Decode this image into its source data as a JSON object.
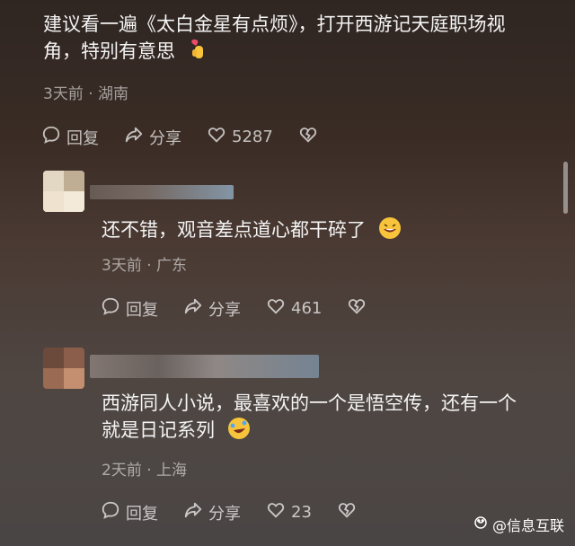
{
  "comment1": {
    "text_line1": "建议看一遍《太白金星有点烦》，打开西游记天庭职场视",
    "text_line2": "角，特别有意思",
    "meta": "3天前 · 湖南",
    "reply_label": "回复",
    "share_label": "分享",
    "like_count": "5287"
  },
  "comment2": {
    "text": "还不错，观音差点道心都干碎了",
    "meta": "3天前 · 广东",
    "reply_label": "回复",
    "share_label": "分享",
    "like_count": "461"
  },
  "comment3": {
    "text_line1": "西游同人小说，最喜欢的一个是悟空传，还有一个",
    "text_line2": "就是日记系列",
    "meta": "2天前 · 上海",
    "reply_label": "回复",
    "share_label": "分享",
    "like_count": "23"
  },
  "watermark": {
    "text": "@信息互联"
  },
  "icons": {
    "reply": "comment-bubble-icon",
    "share": "share-arrow-icon",
    "like": "heart-icon",
    "dislike": "broken-heart-icon"
  },
  "colors": {
    "text_primary": "#f4f4f4",
    "text_muted": "#9c918c",
    "emoji_yellow": "#f7c43b"
  }
}
